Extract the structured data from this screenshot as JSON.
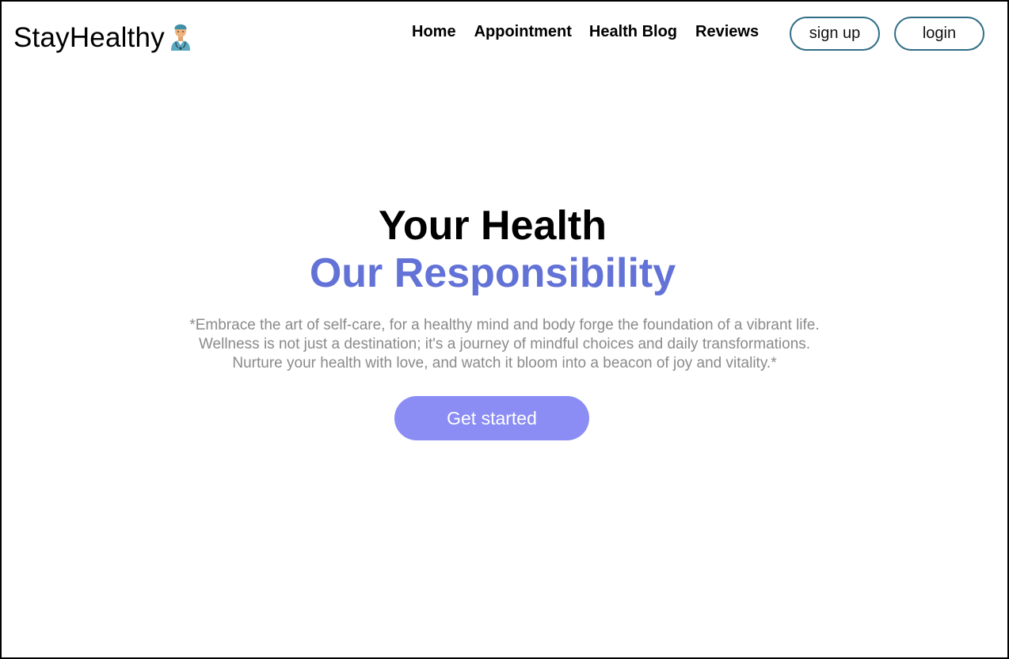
{
  "brand": {
    "name": "StayHealthy",
    "icon": "doctor-icon"
  },
  "nav": {
    "items": [
      {
        "label": "Home"
      },
      {
        "label": "Appointment"
      },
      {
        "label": "Health Blog"
      },
      {
        "label": "Reviews"
      }
    ],
    "signup_label": "sign up",
    "login_label": "login"
  },
  "hero": {
    "title_line1": "Your Health",
    "title_line2": "Our Responsibility",
    "description_lines": [
      "*Embrace the art of self-care, for a healthy mind and body forge the foundation of a vibrant life.",
      "Wellness is not just a destination; it's a journey of mindful choices and daily transformations.",
      "Nurture your health with love, and watch it bloom into a beacon of joy and vitality.*"
    ],
    "cta_label": "Get started"
  },
  "colors": {
    "accent": "#6272d6",
    "button_fill": "#8b8df5",
    "outline": "#2f6d86",
    "muted_text": "#8a8a8a"
  }
}
